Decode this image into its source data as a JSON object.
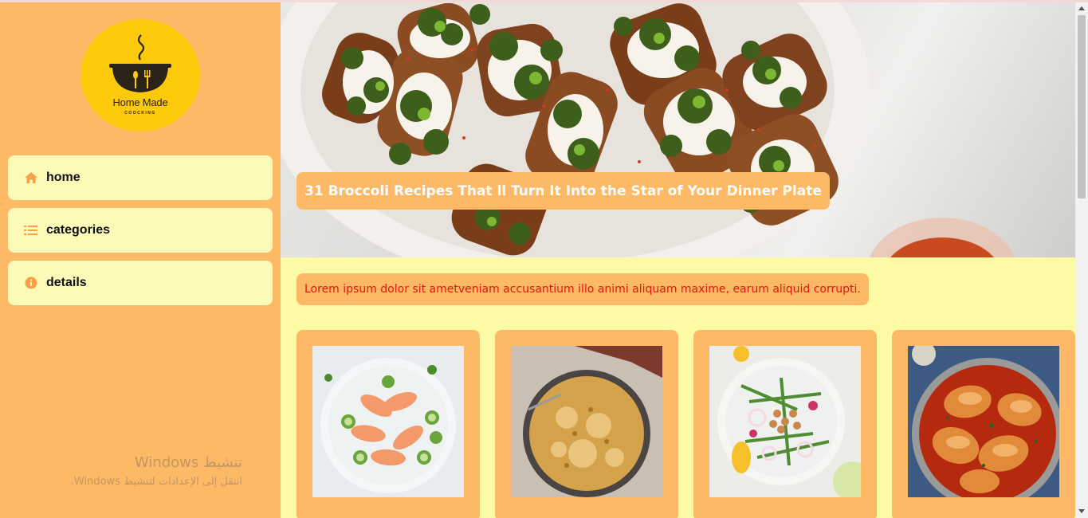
{
  "brand": {
    "name": "Home Made",
    "tagline": "COOCKING"
  },
  "nav": [
    {
      "label": "home",
      "icon": "home-icon"
    },
    {
      "label": "categories",
      "icon": "list-icon"
    },
    {
      "label": "details",
      "icon": "info-icon"
    }
  ],
  "hero": {
    "title": "31 Broccoli Recipes That ll Turn It Into the Star of Your Dinner Plate"
  },
  "intro": "Lorem ipsum dolor sit ametveniam accusantium illo animi aliquam maxime, earum aliquid corrupti.",
  "watermark": {
    "line1": "تنشيط Windows",
    "line2": "انتقل إلى الإعدادات لتنشيط Windows."
  },
  "colors": {
    "sidebar": "#fdb965",
    "nav_bg": "#fdfab7",
    "main_bg": "#fdfaa6",
    "accent": "#fdb965",
    "logo": "#fdc90b",
    "intro_text": "#e3170a"
  }
}
